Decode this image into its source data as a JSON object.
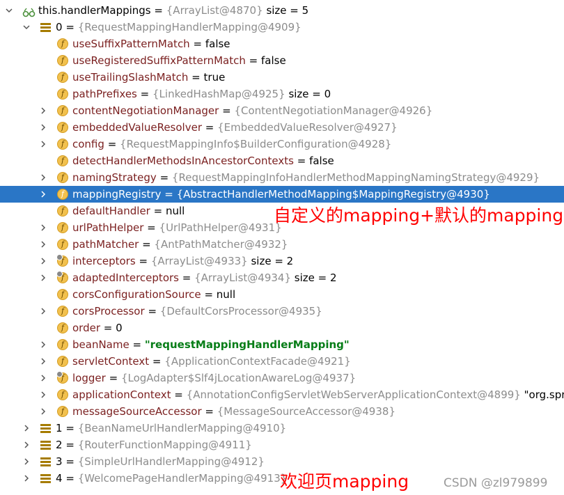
{
  "tree": {
    "root": {
      "name": "this.handlerMappings",
      "ref": "{ArrayList@4870}",
      "extra": "size = 5"
    },
    "items": [
      {
        "index": "0",
        "ref": "{RequestMappingHandlerMapping@4909}"
      },
      {
        "index": "1",
        "ref": "{BeanNameUrlHandlerMapping@4910}"
      },
      {
        "index": "2",
        "ref": "{RouterFunctionMapping@4911}"
      },
      {
        "index": "3",
        "ref": "{SimpleUrlHandlerMapping@4912}"
      },
      {
        "index": "4",
        "ref": "{WelcomePageHandlerMapping@4913}"
      }
    ],
    "fields": [
      {
        "name": "useSuffixPatternMatch",
        "value": "false"
      },
      {
        "name": "useRegisteredSuffixPatternMatch",
        "value": "false"
      },
      {
        "name": "useTrailingSlashMatch",
        "value": "true"
      },
      {
        "name": "pathPrefixes",
        "ref": "{LinkedHashMap@4925}",
        "extra": "size = 0"
      },
      {
        "name": "contentNegotiationManager",
        "ref": "{ContentNegotiationManager@4926}"
      },
      {
        "name": "embeddedValueResolver",
        "ref": "{EmbeddedValueResolver@4927}"
      },
      {
        "name": "config",
        "ref": "{RequestMappingInfo$BuilderConfiguration@4928}"
      },
      {
        "name": "detectHandlerMethodsInAncestorContexts",
        "value": "false"
      },
      {
        "name": "namingStrategy",
        "ref": "{RequestMappingInfoHandlerMethodMappingNamingStrategy@4929}"
      },
      {
        "name": "mappingRegistry",
        "ref": "{AbstractHandlerMethodMapping$MappingRegistry@4930}"
      },
      {
        "name": "defaultHandler",
        "value": "null"
      },
      {
        "name": "urlPathHelper",
        "ref": "{UrlPathHelper@4931}"
      },
      {
        "name": "pathMatcher",
        "ref": "{AntPathMatcher@4932}"
      },
      {
        "name": "interceptors",
        "ref": "{ArrayList@4933}",
        "extra": "size = 2"
      },
      {
        "name": "adaptedInterceptors",
        "ref": "{ArrayList@4934}",
        "extra": "size = 2"
      },
      {
        "name": "corsConfigurationSource",
        "value": "null"
      },
      {
        "name": "corsProcessor",
        "ref": "{DefaultCorsProcessor@4935}"
      },
      {
        "name": "order",
        "value": "0"
      },
      {
        "name": "beanName",
        "str": "\"requestMappingHandlerMapping\""
      },
      {
        "name": "servletContext",
        "ref": "{ApplicationContextFacade@4921}"
      },
      {
        "name": "logger",
        "ref": "{LogAdapter$Slf4jLocationAwareLog@4937}"
      },
      {
        "name": "applicationContext",
        "ref": "{AnnotationConfigServletWebServerApplicationContext@4899}",
        "extra": "\"org.spring"
      },
      {
        "name": "messageSourceAccessor",
        "ref": "{MessageSourceAccessor@4938}"
      }
    ],
    "eq": "="
  },
  "annotations": {
    "mapping_note": "自定义的mapping+默认的mapping",
    "welcome_note": "欢迎页mapping"
  },
  "watermark": "CSDN @zl979899",
  "colors": {
    "selected": "#2a76c6",
    "annotation": "#ff0000",
    "field_name": "#7a1f1f",
    "ref": "#8c8c8c",
    "string": "#067d17"
  }
}
